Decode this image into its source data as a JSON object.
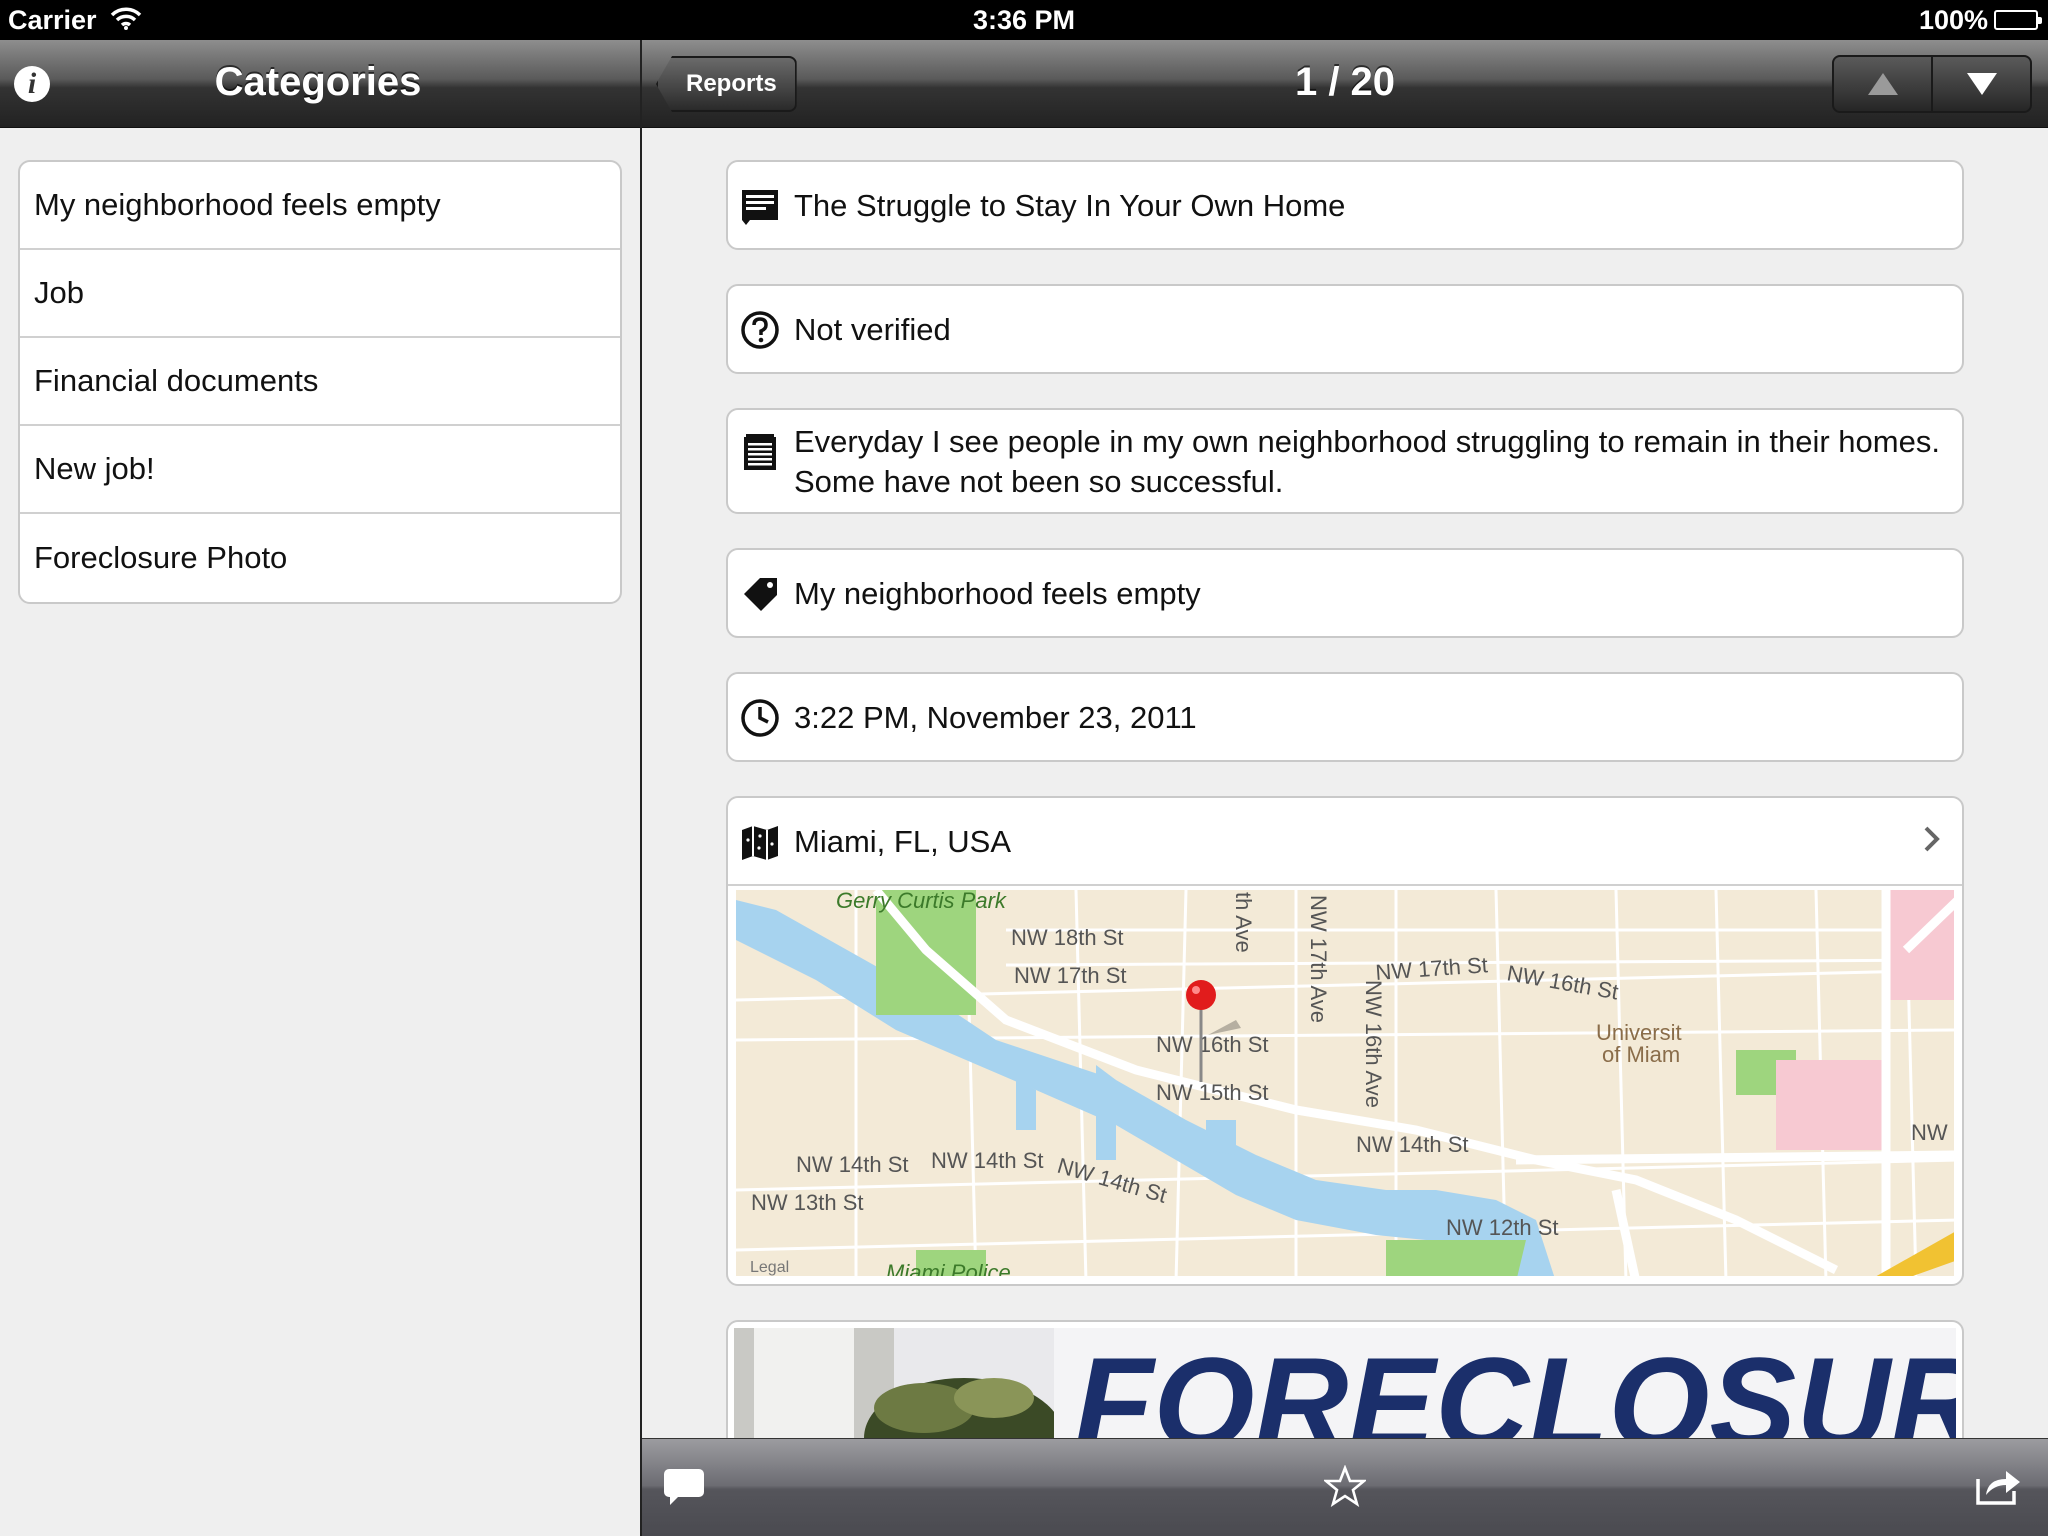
{
  "status_bar": {
    "carrier": "Carrier",
    "time": "3:36 PM",
    "battery": "100%"
  },
  "left_nav": {
    "title": "Categories",
    "info_icon": "info-icon",
    "info_glyph": "i"
  },
  "categories": [
    {
      "label": "My neighborhood feels empty"
    },
    {
      "label": "Job"
    },
    {
      "label": "Financial documents"
    },
    {
      "label": "New job!"
    },
    {
      "label": "Foreclosure Photo"
    }
  ],
  "right_nav": {
    "back_label": "Reports",
    "title": "1 / 20",
    "up_icon": "triangle-up-icon",
    "down_icon": "triangle-down-icon"
  },
  "report": {
    "title": "The Struggle to Stay In Your Own Home",
    "verification": "Not verified",
    "description": "Everyday I see people in my own neighborhood struggling to remain in their homes. Some have not been so successful.",
    "category": "My neighborhood feels empty",
    "datetime": "3:22 PM, November 23, 2011",
    "location": "Miami, FL, USA"
  },
  "map": {
    "labels": {
      "park": "Gerry Curtis Park",
      "nw18": "NW 18th St",
      "nw17a": "NW 17th St",
      "nw17b": "NW 17th St",
      "nw16a": "NW 16th St",
      "nw16_pin": "NW 16th St",
      "nw15": "NW 15th St",
      "nw14a": "NW 14th St",
      "nw14b": "NW 14th St",
      "nw14c": "NW 14th St",
      "nw14d": "NW 14th St",
      "nw13": "NW 13th St",
      "nw12": "NW 12th St",
      "ave17": "NW 17th Ave",
      "ave16": "NW 16th Ave",
      "th_ave": "th Ave",
      "univ1": "Universit",
      "univ2": "of Miam",
      "nw_right": "NW",
      "police": "Miami Police",
      "legal": "Legal"
    }
  },
  "photo": {
    "sign_text": "FORECLOSURE"
  },
  "toolbar": {
    "comment_icon": "comment-icon",
    "favorite_icon": "star-icon",
    "share_icon": "share-icon"
  },
  "colors": {
    "water": "#a7d3ef",
    "park": "#9ed57e",
    "land": "#f3ead7",
    "road": "#ffffff",
    "pin": "#e11c1c",
    "university": "#f7c9d2"
  }
}
